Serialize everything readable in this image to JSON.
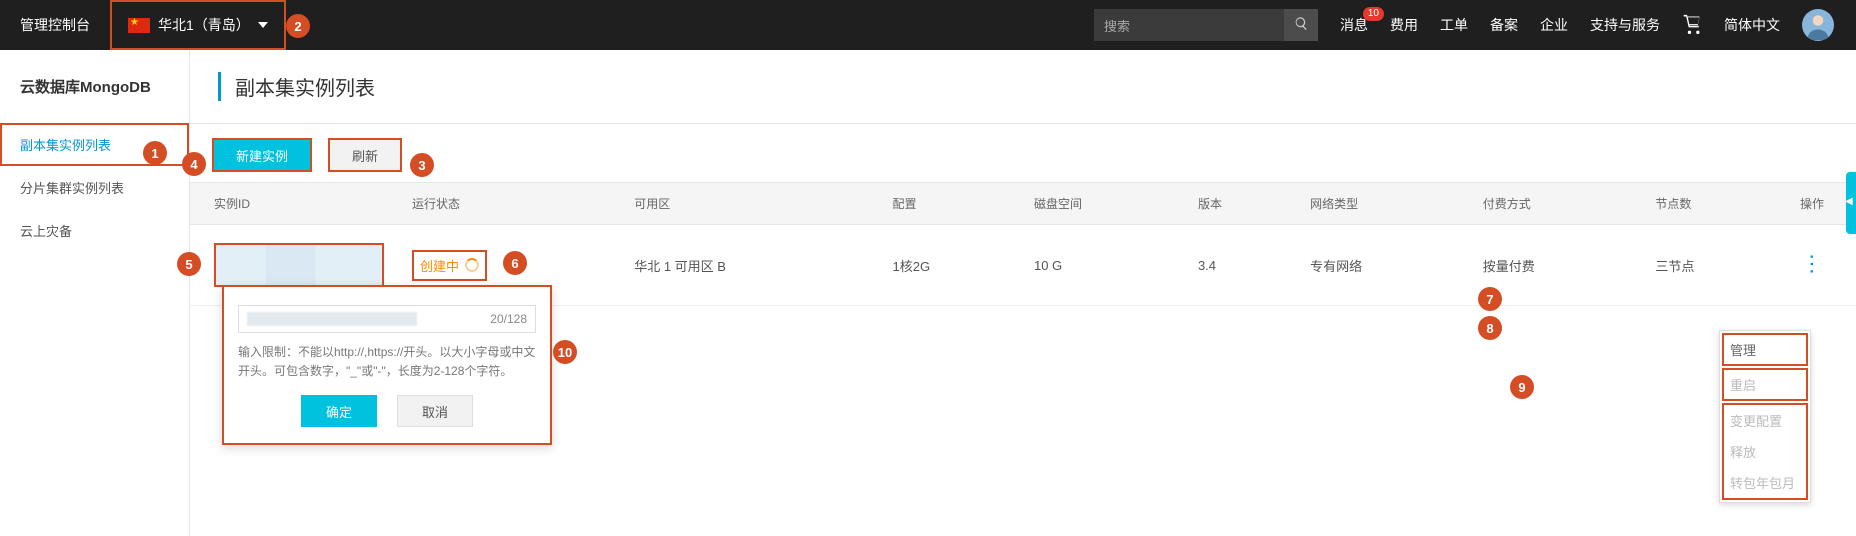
{
  "header": {
    "console": "管理控制台",
    "region": "华北1（青岛）",
    "search_placeholder": "搜索",
    "nav": {
      "messages": "消息",
      "messages_badge": "10",
      "billing": "费用",
      "tickets": "工单",
      "icp": "备案",
      "enterprise": "企业",
      "support": "支持与服务",
      "language": "简体中文"
    }
  },
  "sidebar": {
    "product": "云数据库MongoDB",
    "items": [
      "副本集实例列表",
      "分片集群实例列表",
      "云上灾备"
    ]
  },
  "page": {
    "title": "副本集实例列表",
    "btn_new": "新建实例",
    "btn_refresh": "刷新"
  },
  "table": {
    "columns": [
      "实例ID",
      "运行状态",
      "可用区",
      "配置",
      "磁盘空间",
      "版本",
      "网络类型",
      "付费方式",
      "节点数",
      "操作"
    ],
    "row": {
      "status": "创建中",
      "zone": "华北 1 可用区 B",
      "config": "1核2G",
      "disk": "10 G",
      "version": "3.4",
      "network": "专有网络",
      "billing": "按量付费",
      "nodes": "三节点"
    }
  },
  "dropdown": {
    "manage": "管理",
    "restart": "重启",
    "change_spec": "变更配置",
    "release": "释放",
    "to_subscription": "转包年包月"
  },
  "popover": {
    "char_count": "20/128",
    "hint": "输入限制：不能以http://,https://开头。以大小字母或中文开头。可包含数字，\"_\"或\"-\"，长度为2-128个字符。",
    "ok": "确定",
    "cancel": "取消"
  },
  "callouts": {
    "1": "1",
    "2": "2",
    "3": "3",
    "4": "4",
    "5": "5",
    "6": "6",
    "7": "7",
    "8": "8",
    "9": "9",
    "10": "10"
  }
}
